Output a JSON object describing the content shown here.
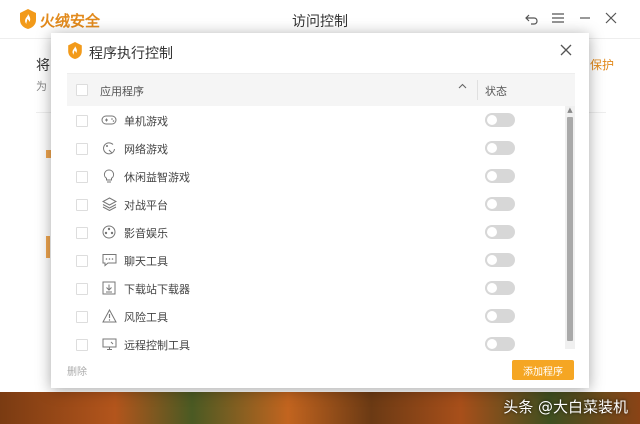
{
  "app": {
    "name": "火绒安全",
    "window_title": "访问控制",
    "bg_heading_partial": "将",
    "bg_sub_partial": "为",
    "bg_link_partial": "保护"
  },
  "dialog": {
    "title": "程序执行控制",
    "columns": {
      "name": "应用程序",
      "status": "状态"
    },
    "rows": [
      {
        "label": "单机游戏",
        "icon": "gamepad-icon",
        "enabled": false
      },
      {
        "label": "网络游戏",
        "icon": "network-game-icon",
        "enabled": false
      },
      {
        "label": "休闲益智游戏",
        "icon": "lightbulb-icon",
        "enabled": false
      },
      {
        "label": "对战平台",
        "icon": "layers-icon",
        "enabled": false
      },
      {
        "label": "影音娱乐",
        "icon": "media-icon",
        "enabled": false
      },
      {
        "label": "聊天工具",
        "icon": "chat-icon",
        "enabled": false
      },
      {
        "label": "下载站下载器",
        "icon": "download-icon",
        "enabled": false
      },
      {
        "label": "风险工具",
        "icon": "warning-icon",
        "enabled": false
      },
      {
        "label": "远程控制工具",
        "icon": "remote-desktop-icon",
        "enabled": false
      }
    ],
    "delete_label": "删除",
    "add_label": "添加程序"
  },
  "watermark": "头条 @大白菜装机",
  "colors": {
    "accent": "#f5a623",
    "brand": "#e28a1c"
  }
}
